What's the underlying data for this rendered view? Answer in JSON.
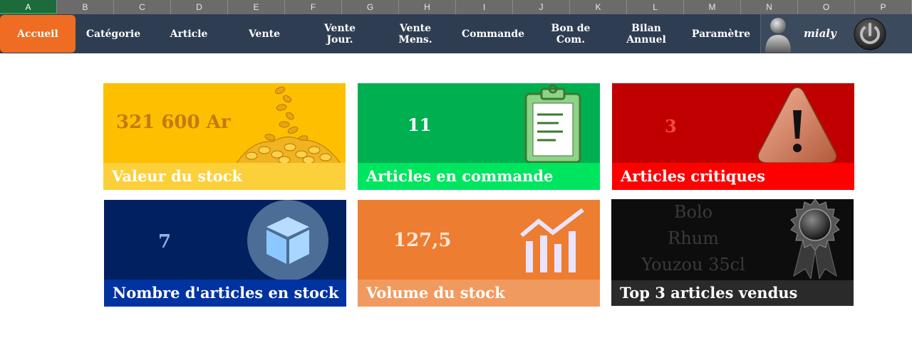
{
  "columns": [
    "A",
    "B",
    "C",
    "D",
    "E",
    "F",
    "G",
    "H",
    "I",
    "J",
    "K",
    "L",
    "M",
    "N",
    "O",
    "P"
  ],
  "nav": {
    "items": [
      {
        "label": "Accueil"
      },
      {
        "label": "Catégorie"
      },
      {
        "label": "Article"
      },
      {
        "label": "Vente"
      },
      {
        "label": "Vente\nJour."
      },
      {
        "label": "Vente\nMens."
      },
      {
        "label": "Commande"
      },
      {
        "label": "Bon de\nCom."
      },
      {
        "label": "Bilan\nAnnuel"
      },
      {
        "label": "Paramètre"
      }
    ],
    "user": "mialy"
  },
  "tiles": {
    "stock_value": {
      "value": "321 600 Ar",
      "caption": "Valeur du stock"
    },
    "orders": {
      "value": "11",
      "caption": "Articles en commande"
    },
    "critical": {
      "value": "3",
      "caption": "Articles critiques"
    },
    "in_stock": {
      "value": "7",
      "caption": "Nombre d'articles en stock"
    },
    "volume": {
      "value": "127,5",
      "caption": "Volume du stock"
    },
    "top3": {
      "items": [
        "Bolo",
        "Rhum",
        "Youzou 35cl"
      ],
      "caption": "Top 3 articles vendus"
    }
  },
  "colors": {
    "nav_bg": "#2f3d52",
    "nav_active": "#ee6d22",
    "yellow": "#fdbf00",
    "green": "#00b050",
    "red": "#c00000",
    "navy": "#002060",
    "orange": "#ed7d31",
    "black": "#0d0d0d"
  }
}
